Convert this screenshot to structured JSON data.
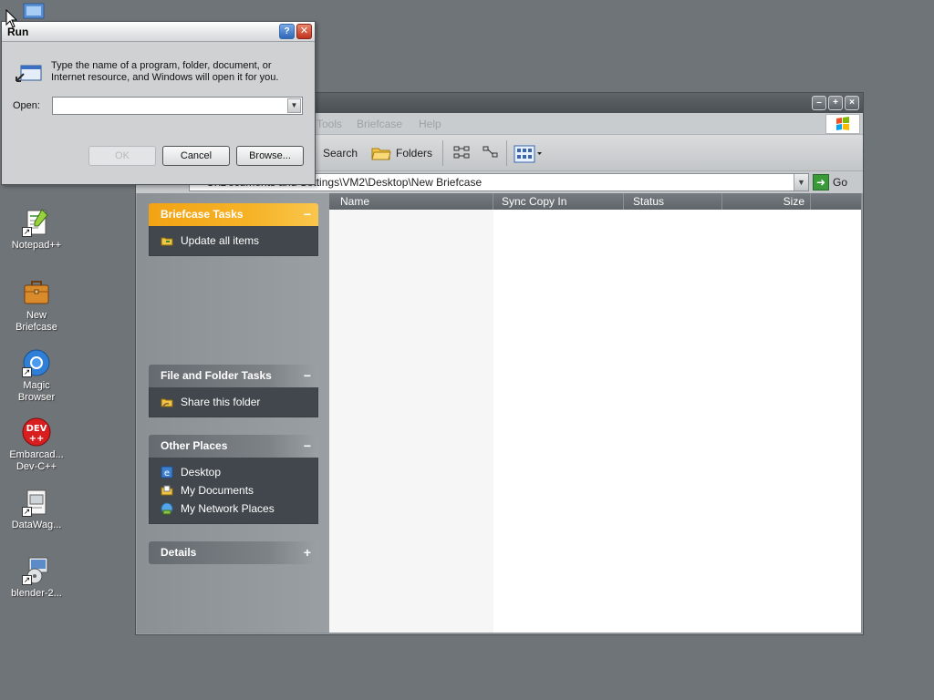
{
  "desktop": {
    "icons": [
      {
        "label": "Notepad++",
        "icon": "notepadpp-icon"
      },
      {
        "label": "New\nBriefcase",
        "icon": "briefcase-icon"
      },
      {
        "label": "Magic\nBrowser",
        "icon": "browser-icon"
      },
      {
        "label": "Embarcad...\nDev-C++",
        "icon": "devcpp-icon",
        "badge": "DEV\n++"
      },
      {
        "label": "DataWag...",
        "icon": "datawag-icon"
      },
      {
        "label": "blender-2...",
        "icon": "installer-icon"
      }
    ]
  },
  "run_dialog": {
    "title": "Run",
    "description": "Type the name of a program, folder, document, or Internet resource, and Windows will open it for you.",
    "open_label": "Open:",
    "open_value": "",
    "ok_label": "OK",
    "cancel_label": "Cancel",
    "browse_label": "Browse..."
  },
  "explorer": {
    "menu": {
      "tools": "Tools",
      "briefcase": "Briefcase",
      "help": "Help"
    },
    "toolbar": {
      "search": "Search",
      "folders": "Folders"
    },
    "address": "C:\\Documents and Settings\\VM2\\Desktop\\New Briefcase",
    "go_label": "Go",
    "task_pane": {
      "briefcase_tasks": {
        "title": "Briefcase Tasks",
        "toggle": "−",
        "items": [
          "Update all items"
        ]
      },
      "file_folder_tasks": {
        "title": "File and Folder Tasks",
        "toggle": "−",
        "items": [
          "Share this folder"
        ]
      },
      "other_places": {
        "title": "Other Places",
        "toggle": "−",
        "items": [
          "Desktop",
          "My Documents",
          "My Network Places"
        ]
      },
      "details": {
        "title": "Details",
        "toggle": "+"
      }
    },
    "columns": [
      "Name",
      "Sync Copy In",
      "Status",
      "Size"
    ]
  },
  "colors": {
    "desktop_bg": "#6f7478",
    "task_header_orange": "#f2a314",
    "task_body": "#41474c"
  }
}
